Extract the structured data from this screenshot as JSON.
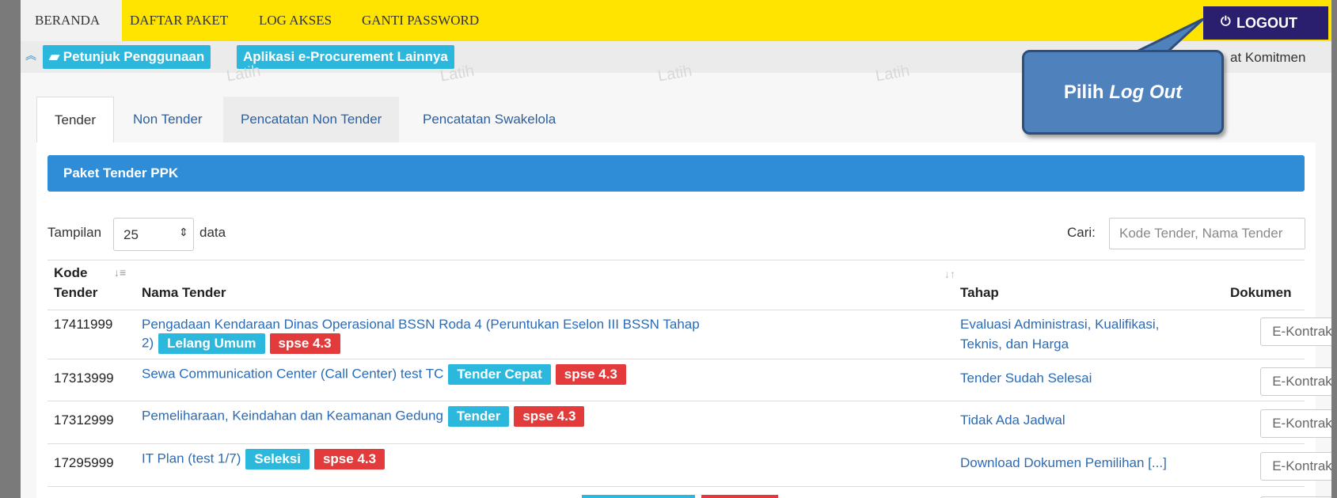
{
  "topnav": {
    "items": [
      "BERANDA",
      "DAFTAR PAKET",
      "LOG AKSES",
      "GANTI PASSWORD"
    ],
    "logout_label": "LOGOUT"
  },
  "subbar": {
    "buttons": [
      "Petunjuk Penggunaan",
      "Aplikasi e-Procurement Lainnya"
    ],
    "right_text": "at Komitmen"
  },
  "watermark_text": "Latih",
  "tabs": [
    "Tender",
    "Non Tender",
    "Pencatatan Non Tender",
    "Pencatatan Swakelola"
  ],
  "panel_title": "Paket Tender PPK",
  "controls": {
    "tampilan_label": "Tampilan",
    "page_size": "25",
    "data_label": "data",
    "cari_label": "Cari:",
    "search_placeholder": "Kode Tender, Nama Tender"
  },
  "table": {
    "headers": [
      "Kode Tender",
      "Nama Tender",
      "Tahap",
      "Dokumen"
    ],
    "kode_header_line1": "Kode",
    "kode_header_line2": "Tender",
    "rows": [
      {
        "kode": "17411999",
        "nama_line1": "Pengadaan Kendaraan Dinas Operasional BSSN Roda 4 (Peruntukan Eselon III BSSN Tahap",
        "nama_line2": "2)",
        "badge": "Lelang Umum",
        "version": "spse 4.3",
        "tahap_line1": "Evaluasi Administrasi, Kualifikasi,",
        "tahap_line2": "Teknis, dan Harga",
        "dokumen": "E-Kontrak"
      },
      {
        "kode": "17313999",
        "nama": "Sewa Communication Center (Call Center) test TC",
        "badge": "Tender Cepat",
        "version": "spse 4.3",
        "tahap": "Tender Sudah Selesai",
        "dokumen": "E-Kontrak"
      },
      {
        "kode": "17312999",
        "nama": "Pemeliharaan, Keindahan dan Keamanan Gedung",
        "badge": "Tender",
        "version": "spse 4.3",
        "tahap": "Tidak Ada Jadwal",
        "dokumen": "E-Kontrak"
      },
      {
        "kode": "17295999",
        "nama": "IT Plan (test 1/7)",
        "badge": "Seleksi",
        "version": "spse 4.3",
        "tahap": "Download Dokumen Pemilihan [...]",
        "dokumen": "E-Kontrak"
      }
    ]
  },
  "callout": {
    "text_plain": "Pilih ",
    "text_italic": "Log Out"
  },
  "colors": {
    "nav_yellow": "#ffe400",
    "logout_bg": "#2a1f6e",
    "panel_blue": "#2f8cd6",
    "badge_cyan": "#2cb8dc",
    "badge_red": "#e33b3b",
    "callout_blue": "#4f81bd"
  }
}
